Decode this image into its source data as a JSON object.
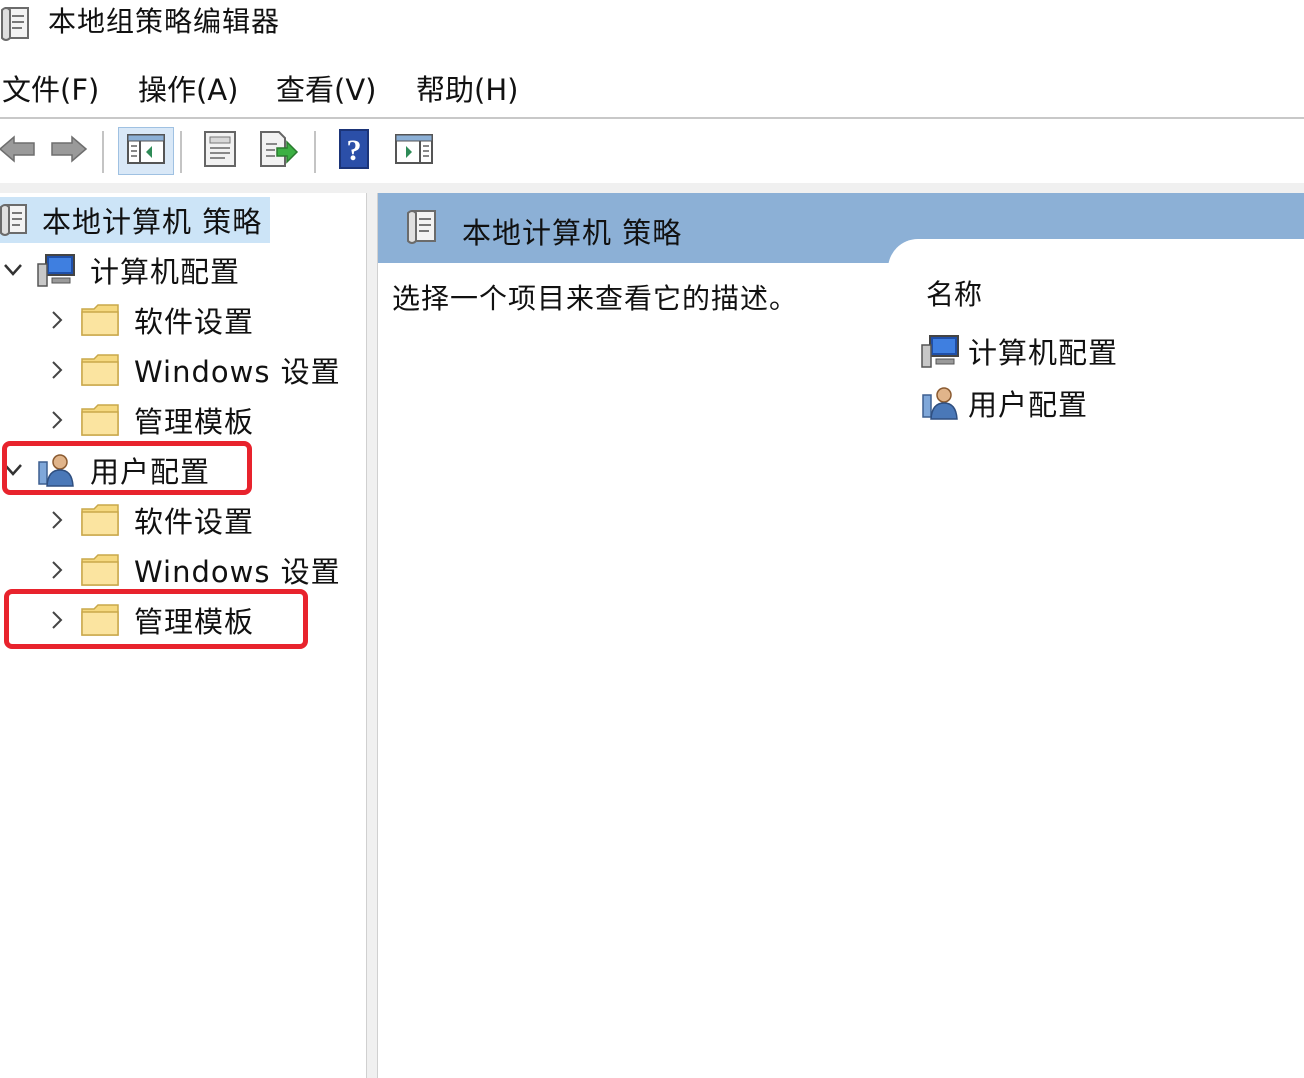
{
  "window": {
    "title": "本地组策略编辑器",
    "icon": "policy-scroll-icon"
  },
  "menu": [
    {
      "label": "文件(F)"
    },
    {
      "label": "操作(A)"
    },
    {
      "label": "查看(V)"
    },
    {
      "label": "帮助(H)"
    }
  ],
  "toolbar": {
    "buttons": [
      {
        "icon": "back-arrow-icon"
      },
      {
        "icon": "forward-arrow-icon"
      },
      {
        "icon": "show-hide-tree-icon",
        "active": true
      },
      {
        "icon": "properties-icon"
      },
      {
        "icon": "export-list-icon"
      },
      {
        "icon": "help-icon"
      },
      {
        "icon": "show-action-pane-icon"
      }
    ]
  },
  "tree": {
    "root": {
      "label": "本地计算机 策略",
      "icon": "policy-scroll-icon"
    },
    "computer_config": {
      "label": "计算机配置",
      "icon": "computer-icon",
      "expanded": true,
      "children": [
        {
          "label": "软件设置",
          "icon": "folder-icon"
        },
        {
          "label": "Windows 设置",
          "icon": "folder-icon"
        },
        {
          "label": "管理模板",
          "icon": "folder-icon"
        }
      ]
    },
    "user_config": {
      "label": "用户配置",
      "icon": "user-icon",
      "expanded": true,
      "highlighted": true,
      "children": [
        {
          "label": "软件设置",
          "icon": "folder-icon"
        },
        {
          "label": "Windows 设置",
          "icon": "folder-icon"
        },
        {
          "label": "管理模板",
          "icon": "folder-icon",
          "highlighted": true
        }
      ]
    }
  },
  "content": {
    "header_title": "本地计算机 策略",
    "description": "选择一个项目来查看它的描述。",
    "column_name": "名称",
    "items": [
      {
        "label": "计算机配置",
        "icon": "computer-icon"
      },
      {
        "label": "用户配置",
        "icon": "user-icon"
      }
    ]
  },
  "colors": {
    "highlight_border": "#e8232d",
    "header_band": "#8cb0d6",
    "root_selection": "#cce4f7",
    "folder": "#f5d87f"
  }
}
